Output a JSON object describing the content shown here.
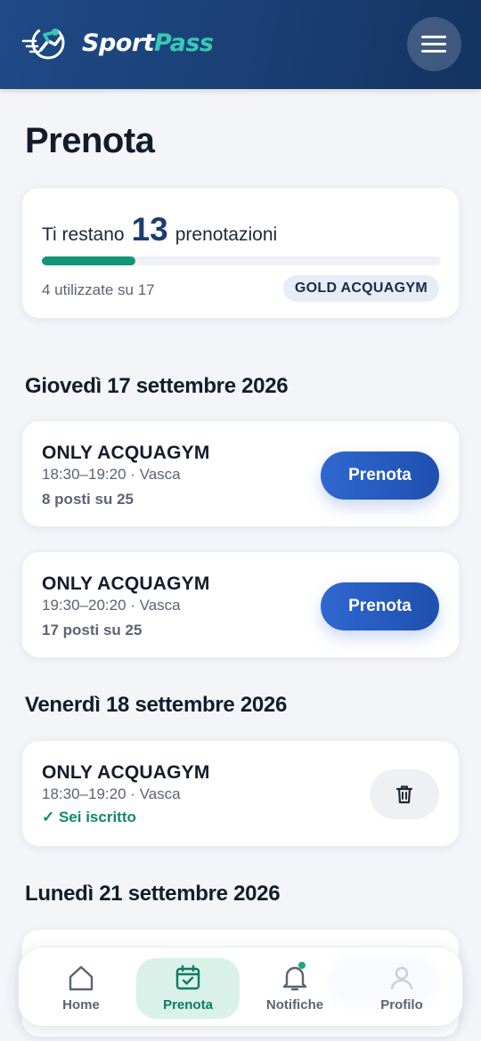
{
  "header": {
    "brand_part1": "Sport",
    "brand_part2": "Pass",
    "accent_color": "#37c9b4",
    "background_color": "#1f4a86",
    "menu_icon": "hamburger-menu-icon",
    "logo_icon": "running-figure-logo-icon"
  },
  "page": {
    "title": "Prenota"
  },
  "summary": {
    "prefix": "Ti restano",
    "remaining": "13",
    "suffix": "prenotazioni",
    "used_text": "4 utilizzate su 17",
    "progress_fraction": 0.2353,
    "plan": "GOLD ACQUAGYM",
    "progress_color": "#139577"
  },
  "days": [
    {
      "date": "Giovedì 17 settembre 2026",
      "sessions": [
        {
          "title": "ONLY ACQUAGYM",
          "meta": "18:30–19:20 · Vasca",
          "seats": "8 posti su 25",
          "action": "Prenota"
        },
        {
          "title": "ONLY ACQUAGYM",
          "meta": "19:30–20:20 · Vasca",
          "seats": "17 posti su 25",
          "action": "Prenota"
        }
      ]
    },
    {
      "date": "Venerdì 18 settembre 2026",
      "sessions": [
        {
          "title": "ONLY ACQUAGYM",
          "meta": "18:30–19:20 · Vasca",
          "status": "✓ Sei iscritto",
          "action_icon": "trash-icon"
        }
      ]
    },
    {
      "date": "Lunedì 21 settembre 2026",
      "sessions": []
    }
  ],
  "bottom_nav": {
    "items": [
      {
        "label": "Home",
        "icon": "home-icon",
        "active": false
      },
      {
        "label": "Prenota",
        "icon": "calendar-check-icon",
        "active": true
      },
      {
        "label": "Notifiche",
        "icon": "bell-icon",
        "active": false,
        "has_dot": true
      },
      {
        "label": "Profilo",
        "icon": "user-icon",
        "active": false
      }
    ]
  },
  "colors": {
    "primary_button": "#2f68d0",
    "success": "#0f8a6a",
    "nav_active_bg": "#d9f1e9"
  }
}
